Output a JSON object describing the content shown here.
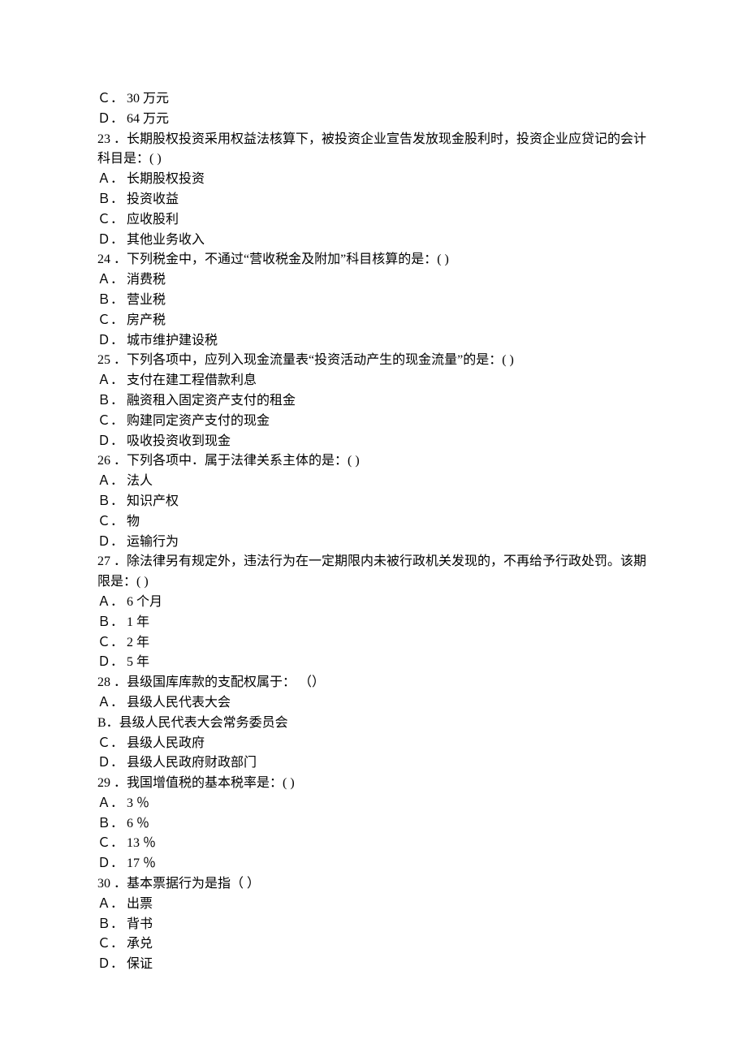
{
  "orphan_options": [
    "Ｃ． 30 万元",
    "Ｄ． 64 万元"
  ],
  "questions": [
    {
      "num": "23",
      "stem": "长期股权投资采用权益法核算下，被投资企业宣告发放现金股利时，投资企业应贷记的会计科目是：(  )",
      "options": [
        "Ａ． 长期股权投资",
        "Ｂ． 投资收益",
        "Ｃ． 应收股利",
        "Ｄ． 其他业务收入"
      ]
    },
    {
      "num": "24",
      "stem": "下列税金中，不通过“营收税金及附加”科目核算的是：(  )",
      "options": [
        "Ａ． 消费税",
        "Ｂ． 营业税",
        "Ｃ． 房产税",
        "Ｄ． 城市维护建设税"
      ]
    },
    {
      "num": "25",
      "stem": "下列各项中，应列入现金流量表“投资活动产生的现金流量”的是：(  )",
      "options": [
        "Ａ． 支付在建工程借款利息",
        "Ｂ． 融资租入固定资产支付的租金",
        "Ｃ． 购建同定资产支付的现金",
        "Ｄ． 吸收投资收到现金"
      ]
    },
    {
      "num": "26",
      "stem": "下列各项中．属于法律关系主体的是：(  )",
      "options": [
        "Ａ． 法人",
        "Ｂ． 知识产权",
        "Ｃ． 物",
        "Ｄ． 运输行为"
      ]
    },
    {
      "num": "27",
      "stem": "除法律另有规定外，违法行为在一定期限内未被行政机关发现的，不再给予行政处罚。该期限是：(  )",
      "options": [
        "Ａ． 6 个月",
        "Ｂ． 1 年",
        "Ｃ． 2 年",
        "Ｄ． 5 年"
      ]
    },
    {
      "num": "28",
      "stem": "县级国库库款的支配权属于： （）",
      "options": [
        "Ａ． 县级人民代表大会",
        "B．县级人民代表大会常务委员会",
        "Ｃ． 县级人民政府",
        "Ｄ． 县级人民政府财政部门"
      ]
    },
    {
      "num": "29",
      "stem": "我国增值税的基本税率是：(  )",
      "options": [
        "Ａ． 3 ％",
        "Ｂ． 6 ％",
        "Ｃ． 13 ％",
        "Ｄ． 17 ％"
      ]
    },
    {
      "num": "30",
      "stem": "基本票据行为是指（ ）",
      "options": [
        "Ａ． 出票",
        "Ｂ． 背书",
        "Ｃ． 承兑",
        "Ｄ． 保证"
      ]
    }
  ]
}
